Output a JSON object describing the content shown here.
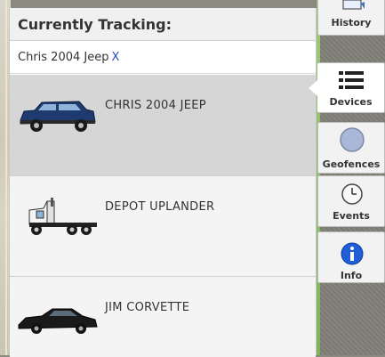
{
  "panel": {
    "title": "Currently Tracking:",
    "tracking_name": "Chris 2004 Jeep",
    "remove_label": "X"
  },
  "vehicles": [
    {
      "name": "CHRIS 2004 JEEP",
      "icon": "suv-icon",
      "color": "#1e3a6e"
    },
    {
      "name": "DEPOT UPLANDER",
      "icon": "semi-truck-icon",
      "color": "#f0f0f0"
    },
    {
      "name": "JIM CORVETTE",
      "icon": "sports-car-icon",
      "color": "#1a1a1a"
    }
  ],
  "tabs": [
    {
      "label": "History",
      "icon": "history-icon"
    },
    {
      "label": "Devices",
      "icon": "list-icon"
    },
    {
      "label": "Geofences",
      "icon": "geofence-circle-icon"
    },
    {
      "label": "Events",
      "icon": "clock-icon"
    },
    {
      "label": "Info",
      "icon": "info-icon"
    }
  ]
}
